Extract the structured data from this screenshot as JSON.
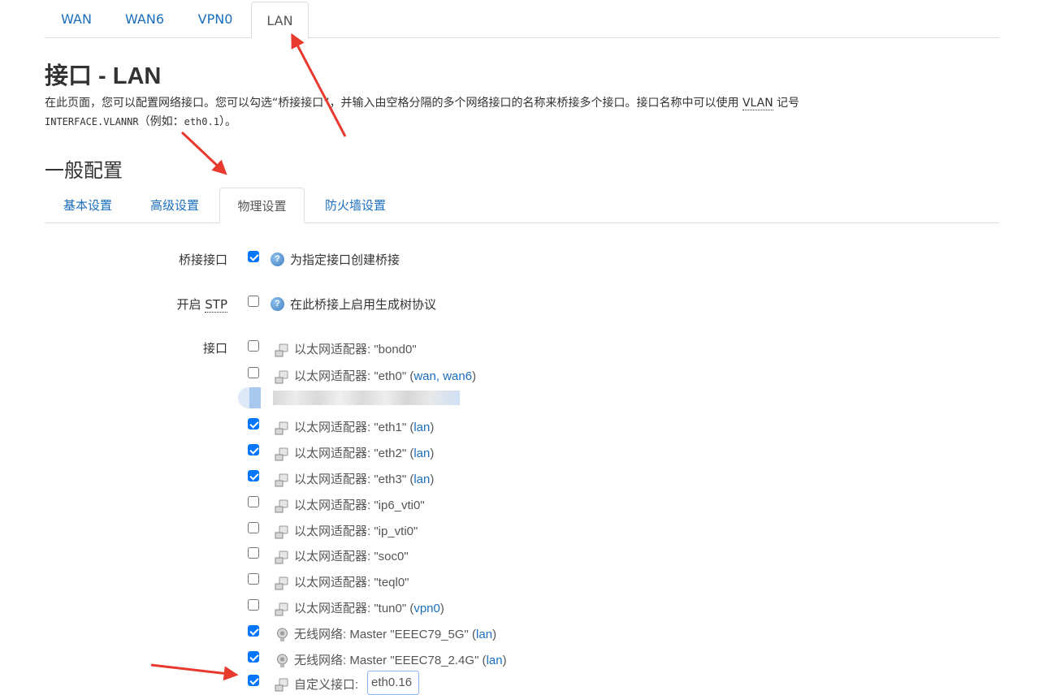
{
  "top_tabs": [
    "WAN",
    "WAN6",
    "VPN0",
    "LAN"
  ],
  "title": "接口 - LAN",
  "description": {
    "part1": "在此页面，您可以配置网络接口。您可以勾选“桥接接口”，并输入由空格分隔的多个网络接口的名称来桥接多个接口。接口名称中可以使用 ",
    "vlan": "VLAN",
    "part2": " 记号",
    "code": "INTERFACE.VLANNR",
    "part3": "（例如：",
    "example": "eth0.1",
    "part4": "）。"
  },
  "section_title": "一般配置",
  "sub_tabs": [
    "基本设置",
    "高级设置",
    "物理设置",
    "防火墙设置"
  ],
  "bridge": {
    "label": "桥接接口",
    "checked": true,
    "help": "为指定接口创建桥接"
  },
  "stp": {
    "label_prefix": "开启 ",
    "label_abbr": "STP",
    "checked": false,
    "help": "在此桥接上启用生成树协议"
  },
  "interfaces_label": "接口",
  "interfaces": [
    {
      "text": "以太网适配器: \"bond0\"",
      "net": "",
      "checked": false
    },
    {
      "text": "以太网适配器: \"eth0\" (",
      "net": "wan, wan6",
      "checked": false
    },
    {
      "text": "以太网适配器: \"eth1\" (",
      "net": "lan",
      "checked": true
    },
    {
      "text": "以太网适配器: \"eth2\" (",
      "net": "lan",
      "checked": true
    },
    {
      "text": "以太网适配器: \"eth3\" (",
      "net": "lan",
      "checked": true
    },
    {
      "text": "以太网适配器: \"ip6_vti0\"",
      "net": "",
      "checked": false
    },
    {
      "text": "以太网适配器: \"ip_vti0\"",
      "net": "",
      "checked": false
    },
    {
      "text": "以太网适配器: \"soc0\"",
      "net": "",
      "checked": false
    },
    {
      "text": "以太网适配器: \"teql0\"",
      "net": "",
      "checked": false
    },
    {
      "text": "以太网适配器: \"tun0\" (",
      "net": "vpn0",
      "checked": false
    },
    {
      "text": "无线网络: Master \"EEEC79_5G\" (",
      "net": "lan",
      "checked": true
    },
    {
      "text": "无线网络: Master \"EEEC78_2.4G\" (",
      "net": "lan",
      "checked": true
    }
  ],
  "custom": {
    "label": "自定义接口:",
    "value": "eth0.16",
    "checked": true
  },
  "colors": {
    "link": "#1a6ebd",
    "checkbox": "#0075ff",
    "arrow": "#e8392f"
  }
}
